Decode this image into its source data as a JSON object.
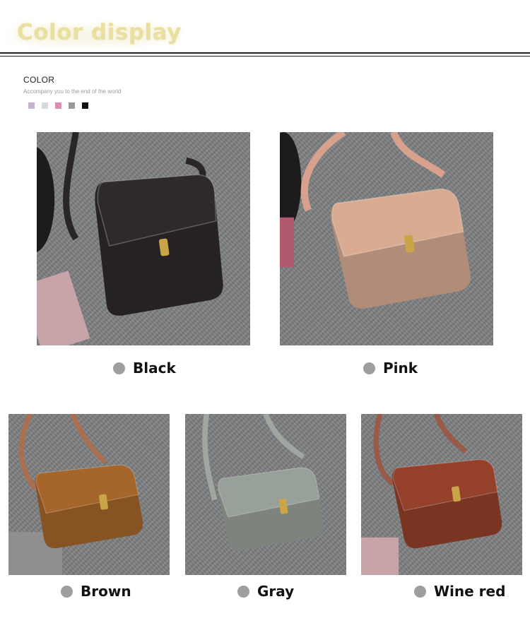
{
  "header": {
    "title": "Color display"
  },
  "section": {
    "heading": "COLOR",
    "subtitle": "Accompany you to the end of the world",
    "swatches": [
      {
        "name": "lilac",
        "color": "#c7b3d0"
      },
      {
        "name": "light-gray",
        "color": "#d9d9d9"
      },
      {
        "name": "pink",
        "color": "#d98fb3"
      },
      {
        "name": "gray",
        "color": "#9a9a9a"
      },
      {
        "name": "black",
        "color": "#111111"
      }
    ]
  },
  "products": [
    {
      "label": "Black",
      "bag_color": "#2e2a2b",
      "strap_color": "#2a2627",
      "icon": "bullet-dot"
    },
    {
      "label": "Pink",
      "bag_color": "#d8ab92",
      "strap_color": "#d7a18d",
      "icon": "bullet-dot"
    },
    {
      "label": "Brown",
      "bag_color": "#a5652b",
      "strap_color": "#a87050",
      "icon": "bullet-dot"
    },
    {
      "label": "Gray",
      "bag_color": "#98a199",
      "strap_color": "#a0a6a0",
      "icon": "bullet-dot"
    },
    {
      "label": "Wine red",
      "bag_color": "#94402a",
      "strap_color": "#9a5a48",
      "icon": "bullet-dot"
    }
  ]
}
